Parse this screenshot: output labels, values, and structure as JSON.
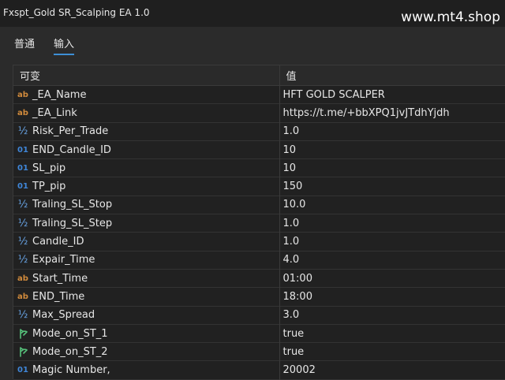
{
  "window": {
    "title": "Fxspt_Gold SR_Scalping EA  1.0",
    "watermark": "www.mt4.shop"
  },
  "tabs": [
    {
      "label": "普通",
      "active": false
    },
    {
      "label": "输入",
      "active": true
    }
  ],
  "table": {
    "headers": {
      "variable": "可变",
      "value": "值"
    },
    "rows": [
      {
        "icon": "ab",
        "name": "_EA_Name",
        "value": "HFT GOLD SCALPER"
      },
      {
        "icon": "ab",
        "name": "_EA_Link",
        "value": "https://t.me/+bbXPQ1jvJTdhYjdh"
      },
      {
        "icon": "half",
        "name": "Risk_Per_Trade",
        "value": "1.0"
      },
      {
        "icon": "bin",
        "name": "END_Candle_ID",
        "value": "10"
      },
      {
        "icon": "bin",
        "name": "SL_pip",
        "value": "10"
      },
      {
        "icon": "bin",
        "name": "TP_pip",
        "value": "150"
      },
      {
        "icon": "half",
        "name": "Traling_SL_Stop",
        "value": "10.0"
      },
      {
        "icon": "half",
        "name": "Traling_SL_Step",
        "value": "1.0"
      },
      {
        "icon": "half",
        "name": "Candle_ID",
        "value": "1.0"
      },
      {
        "icon": "half",
        "name": "Expair_Time",
        "value": "4.0"
      },
      {
        "icon": "ab",
        "name": "Start_Time",
        "value": "01:00"
      },
      {
        "icon": "ab",
        "name": "END_Time",
        "value": "18:00"
      },
      {
        "icon": "half",
        "name": "Max_Spread",
        "value": "3.0"
      },
      {
        "icon": "flag",
        "name": "Mode_on_ST_1",
        "value": "true"
      },
      {
        "icon": "flag",
        "name": "Mode_on_ST_2",
        "value": "true"
      },
      {
        "icon": "bin",
        "name": "Magic Number,",
        "value": "20002"
      }
    ]
  },
  "icon_glyphs": {
    "ab": "ab",
    "half": "½",
    "bin": "01"
  },
  "colors": {
    "accent": "#3d8fd6",
    "string_icon": "#d08a3c",
    "double_icon": "#6aa7ea",
    "int_icon": "#3f86d8",
    "bool_icon": "#56c07a"
  }
}
